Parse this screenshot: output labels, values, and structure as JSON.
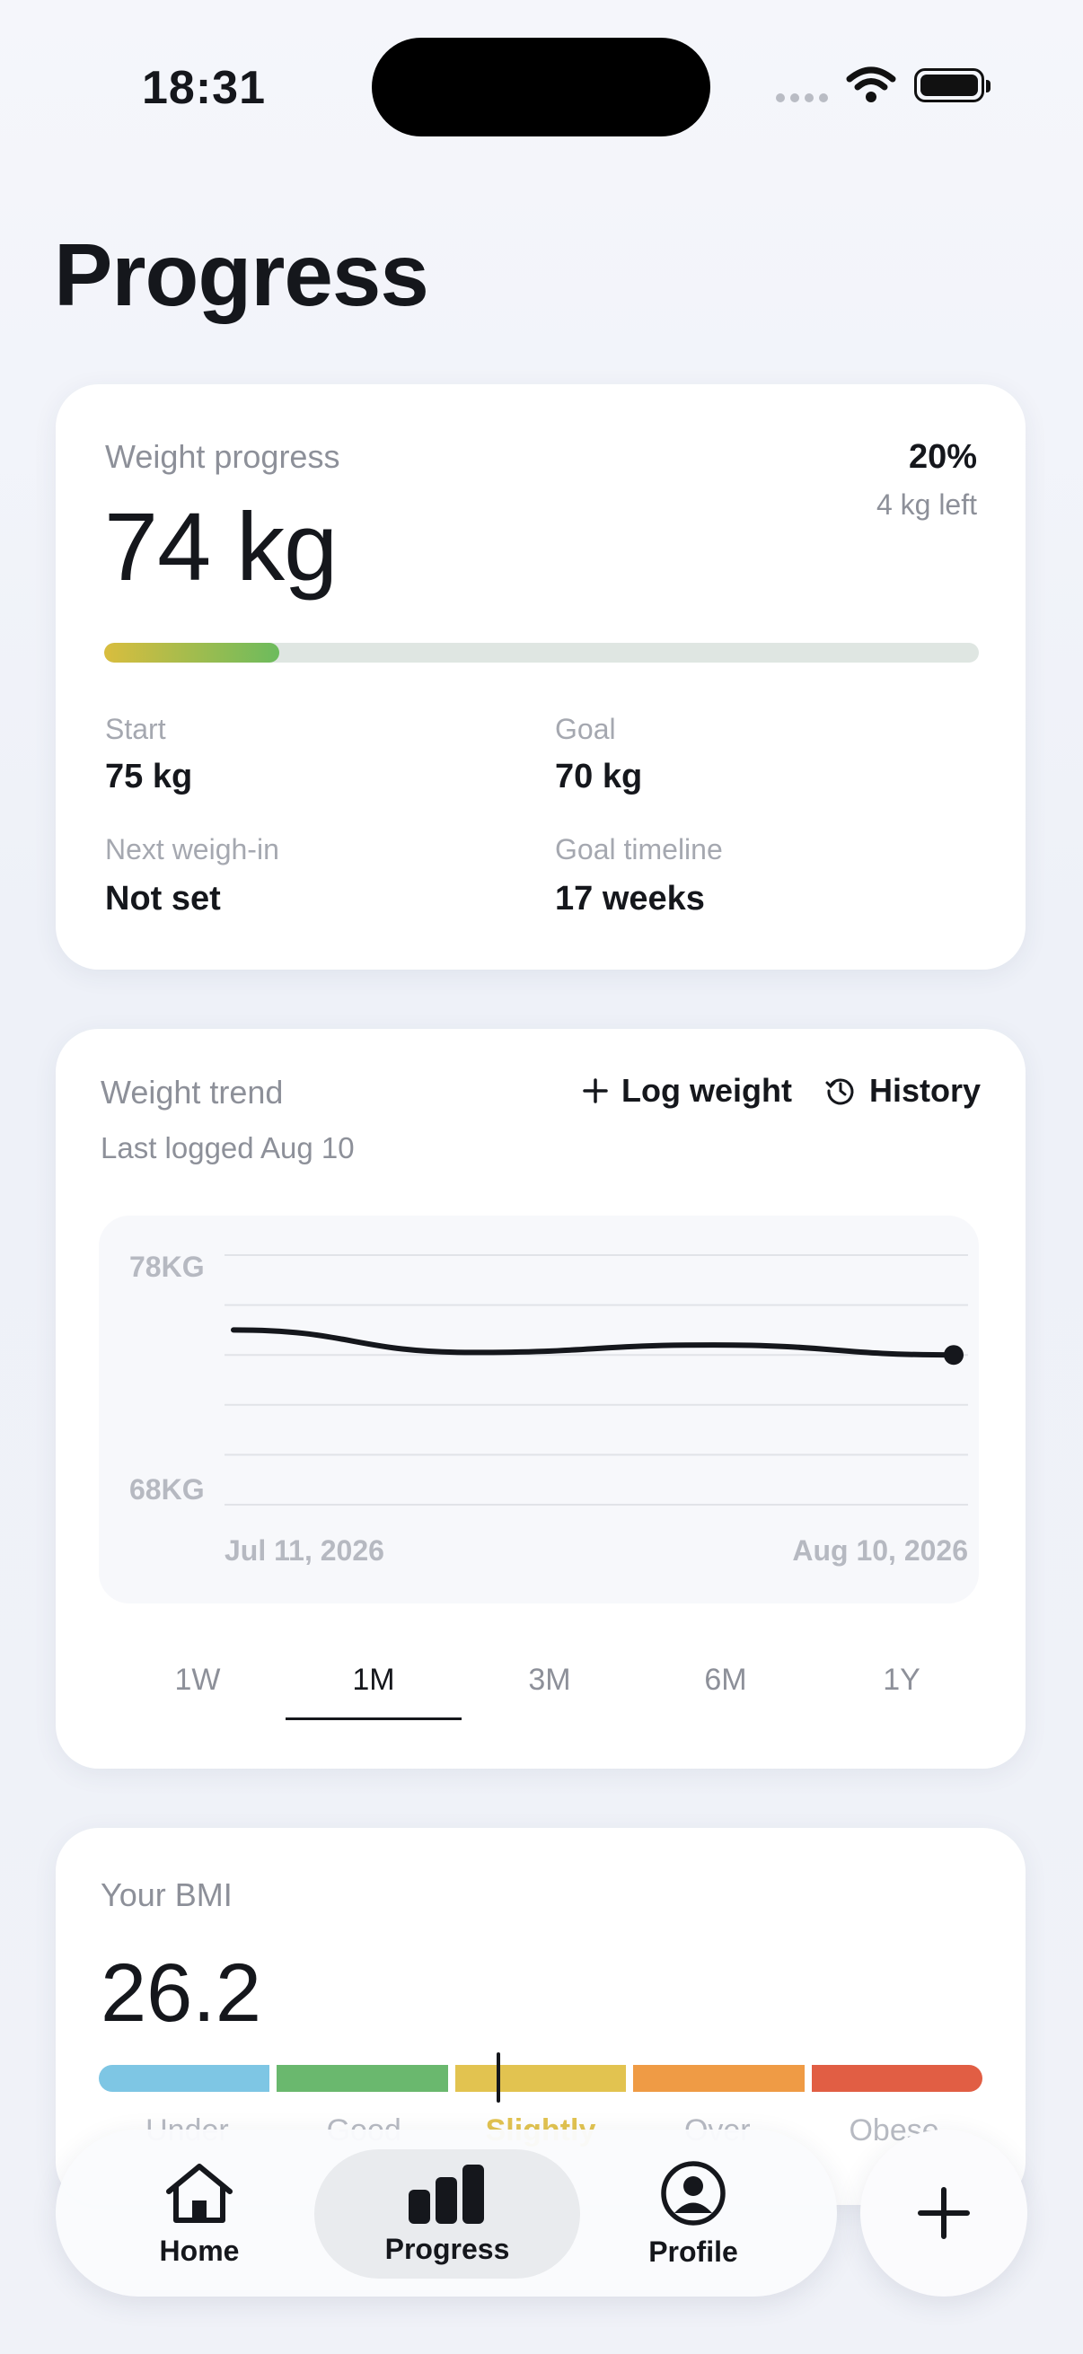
{
  "status": {
    "time": "18:31"
  },
  "page": {
    "title": "Progress"
  },
  "weight_card": {
    "label": "Weight progress",
    "current": "74 kg",
    "percent": "20%",
    "left": "4 kg left",
    "progress_fraction": 0.2,
    "start_label": "Start",
    "start_value": "75 kg",
    "goal_label": "Goal",
    "goal_value": "70 kg",
    "next_label": "Next weigh-in",
    "next_value": "Not set",
    "timeline_label": "Goal timeline",
    "timeline_value": "17 weeks",
    "colors": {
      "gradient_start": "#d9bd3e",
      "gradient_end": "#6cbb5d",
      "track": "#dfe6e2"
    }
  },
  "trend_card": {
    "title": "Weight trend",
    "subtitle": "Last logged Aug 10",
    "log_label": "Log weight",
    "history_label": "History",
    "log_icon": "plus-icon",
    "history_icon": "history-icon",
    "tabs": [
      "1W",
      "1M",
      "3M",
      "6M",
      "1Y"
    ],
    "active_tab": "1M"
  },
  "chart_data": {
    "type": "line",
    "y_ticks": [
      "78KG",
      "68KG"
    ],
    "x_ticks": [
      "Jul 11, 2026",
      "Aug 10, 2026"
    ],
    "ylim": [
      68,
      78
    ],
    "x": [
      "Jul 11, 2026",
      "Jul 21, 2026",
      "Jul 31, 2026",
      "Aug 10, 2026"
    ],
    "series": [
      {
        "values": [
          75.0,
          74.1,
          74.4,
          74.0
        ]
      }
    ],
    "grid": true,
    "title": "",
    "xlabel": "",
    "ylabel": ""
  },
  "bmi_card": {
    "title": "Your BMI",
    "value": "26.2",
    "segments": [
      {
        "label": "Under",
        "color": "#7ec6e4"
      },
      {
        "label": "Good",
        "color": "#6ab86e"
      },
      {
        "label": "Slightly",
        "color": "#e2c350"
      },
      {
        "label": "Over",
        "color": "#ef9b45"
      },
      {
        "label": "Obese",
        "color": "#e15e44"
      }
    ],
    "active_segment": "Slightly"
  },
  "nav": {
    "items": [
      {
        "label": "Home",
        "icon": "home-icon"
      },
      {
        "label": "Progress",
        "icon": "bar-chart-icon"
      },
      {
        "label": "Profile",
        "icon": "user-circle-icon"
      }
    ],
    "active": "Progress",
    "fab_icon": "plus-icon"
  }
}
